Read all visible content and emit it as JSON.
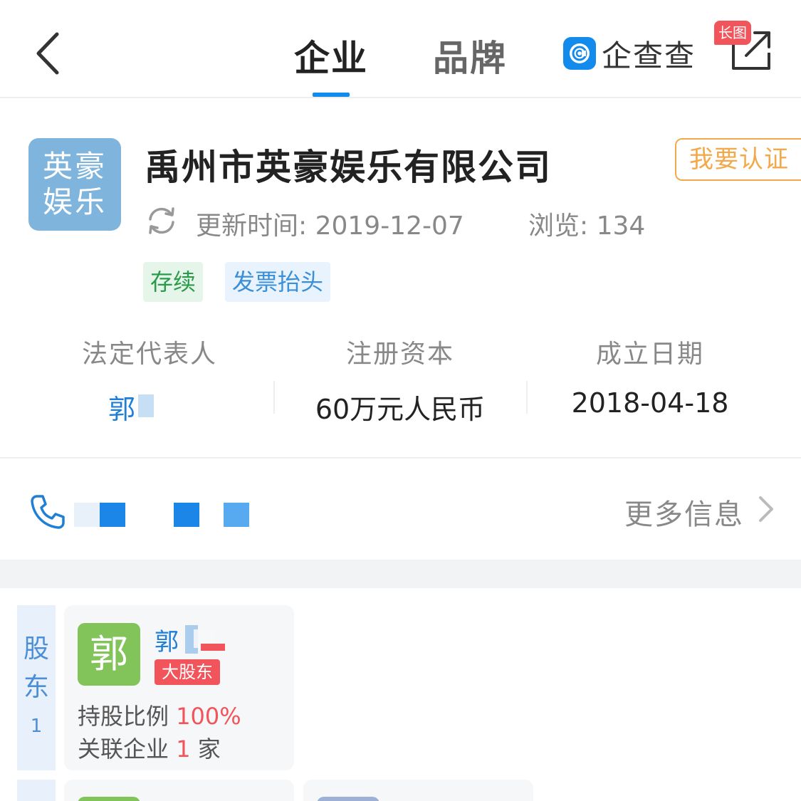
{
  "header": {
    "tabs": [
      {
        "label": "企业",
        "active": true
      },
      {
        "label": "品牌",
        "active": false
      }
    ],
    "logo_text": "企查查",
    "long_image_badge": "长图",
    "accent_color": "#128bed"
  },
  "company": {
    "logo_text_line1": "英豪",
    "logo_text_line2": "娱乐",
    "name": "禹州市英豪娱乐有限公司",
    "certify_label": "我要认证",
    "update_time": "更新时间: 2019-12-07",
    "views": "浏览: 134",
    "tags": [
      {
        "label": "存续"
      },
      {
        "label": "发票抬头"
      }
    ]
  },
  "facts": [
    {
      "label": "法定代表人",
      "value": "郭"
    },
    {
      "label": "注册资本",
      "value": "60万元人民币"
    },
    {
      "label": "成立日期",
      "value": "2018-04-18"
    }
  ],
  "contact": {
    "more_info_label": "更多信息"
  },
  "shareholders": {
    "section_label_1": "股",
    "section_label_2": "东",
    "count": "1",
    "items": [
      {
        "avatar_char": "郭",
        "name": "郭",
        "badge": "大股东",
        "ratio_label": "持股比例 ",
        "ratio_value": "100%",
        "related_label": "关联企业 ",
        "related_value": "1",
        "related_unit": " 家"
      }
    ]
  }
}
